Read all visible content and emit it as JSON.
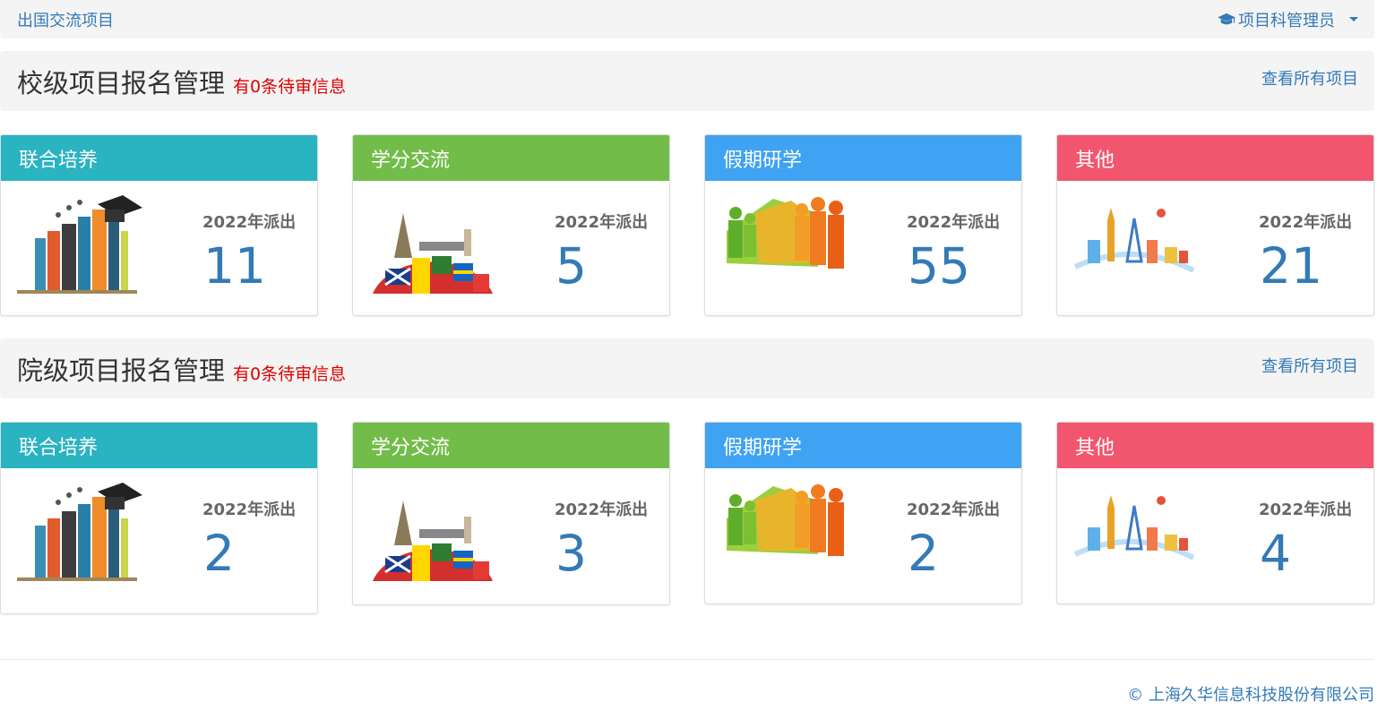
{
  "navbar": {
    "brand": "出国交流项目",
    "user": "项目科管理员",
    "user_icon": "graduation-cap-icon"
  },
  "sections": [
    {
      "title": "校级项目报名管理",
      "pending": "有0条待审信息",
      "view_all": "查看所有项目",
      "cards": [
        {
          "title": "联合培养",
          "color": "#2ab3c0",
          "label": "2022年派出",
          "count": "11",
          "icon": "books-graduation-illustration"
        },
        {
          "title": "学分交流",
          "color": "#72bd4a",
          "label": "2022年派出",
          "count": "5",
          "icon": "globe-flags-illustration"
        },
        {
          "title": "假期研学",
          "color": "#3fa2f2",
          "label": "2022年派出",
          "count": "55",
          "icon": "people-silhouettes-illustration"
        },
        {
          "title": "其他",
          "color": "#f2566f",
          "label": "2022年派出",
          "count": "21",
          "icon": "world-landmarks-illustration"
        }
      ]
    },
    {
      "title": "院级项目报名管理",
      "pending": "有0条待审信息",
      "view_all": "查看所有项目",
      "cards": [
        {
          "title": "联合培养",
          "color": "#2ab3c0",
          "label": "2022年派出",
          "count": "2",
          "icon": "books-graduation-illustration"
        },
        {
          "title": "学分交流",
          "color": "#72bd4a",
          "label": "2022年派出",
          "count": "3",
          "icon": "globe-flags-illustration"
        },
        {
          "title": "假期研学",
          "color": "#3fa2f2",
          "label": "2022年派出",
          "count": "2",
          "icon": "people-silhouettes-illustration"
        },
        {
          "title": "其他",
          "color": "#f2566f",
          "label": "2022年派出",
          "count": "4",
          "icon": "world-landmarks-illustration"
        }
      ]
    }
  ],
  "footer": {
    "copyright": "© 上海久华信息科技股份有限公司"
  }
}
